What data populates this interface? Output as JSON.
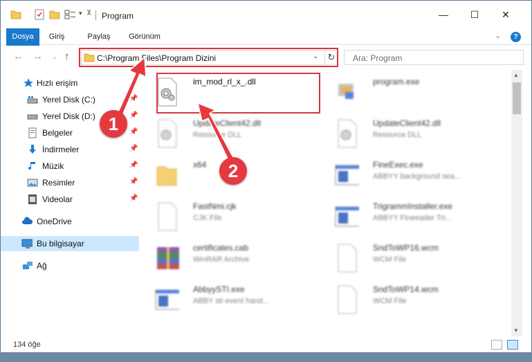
{
  "titlebar": {
    "title": "Program",
    "minimize": "—",
    "maximize": "☐",
    "close": "✕"
  },
  "ribbon": {
    "tabs": [
      "Dosya",
      "Giriş",
      "Paylaş",
      "Görünüm"
    ],
    "help": "?"
  },
  "navigation": {
    "address": "C:\\Program Files\\Program Dizini",
    "search_placeholder": "Ara: Program"
  },
  "sidebar": {
    "items": [
      {
        "label": "Hızlı erişim",
        "icon": "star-icon"
      },
      {
        "label": "Yerel Disk (C:)",
        "icon": "drive-icon"
      },
      {
        "label": "Yerel Disk (D:)",
        "icon": "drive-icon"
      },
      {
        "label": "Belgeler",
        "icon": "documents-icon"
      },
      {
        "label": "İndirmeler",
        "icon": "download-icon"
      },
      {
        "label": "Müzik",
        "icon": "music-icon"
      },
      {
        "label": "Resimler",
        "icon": "pictures-icon"
      },
      {
        "label": "Videolar",
        "icon": "video-icon"
      },
      {
        "label": "OneDrive",
        "icon": "cloud-icon"
      },
      {
        "label": "Bu bilgisayar",
        "icon": "computer-icon"
      },
      {
        "label": "Ağ",
        "icon": "network-icon"
      }
    ]
  },
  "files": [
    {
      "name": "im_mod_rl_x_.dll",
      "type": "",
      "icon": "dll-gear-icon"
    },
    {
      "name": "program.exe",
      "type": "",
      "icon": "exe-icon"
    },
    {
      "name": "UpdateClient42.dll",
      "type": "Resource DLL",
      "icon": "dll-gear-icon"
    },
    {
      "name": "UpdateClient42.dll",
      "type": "Resource DLL",
      "icon": "dll-gear-icon"
    },
    {
      "name": "x64",
      "type": "",
      "icon": "folder-icon"
    },
    {
      "name": "FineExec.exe",
      "type": "ABBYY background sea...",
      "icon": "window-icon"
    },
    {
      "name": "FastNmi.cjk",
      "type": "CJK File",
      "icon": "blank-file-icon"
    },
    {
      "name": "TrigrammInstaller.exe",
      "type": "ABBYY Fineeader Tri...",
      "icon": "window-icon"
    },
    {
      "name": "certificates.cab",
      "type": "WinRAR Archive",
      "icon": "archive-icon"
    },
    {
      "name": "SndToWP16.wcm",
      "type": "WCM File",
      "icon": "blank-file-icon"
    },
    {
      "name": "AbbyySTI.exe",
      "type": "ABBY sti event hand...",
      "icon": "window-icon"
    },
    {
      "name": "SndToWP14.wcm",
      "type": "WCM File",
      "icon": "blank-file-icon"
    }
  ],
  "status": {
    "item_count": "134 öğe"
  },
  "annotations": {
    "badge1": "1",
    "badge2": "2",
    "accent": "#e6393f"
  }
}
